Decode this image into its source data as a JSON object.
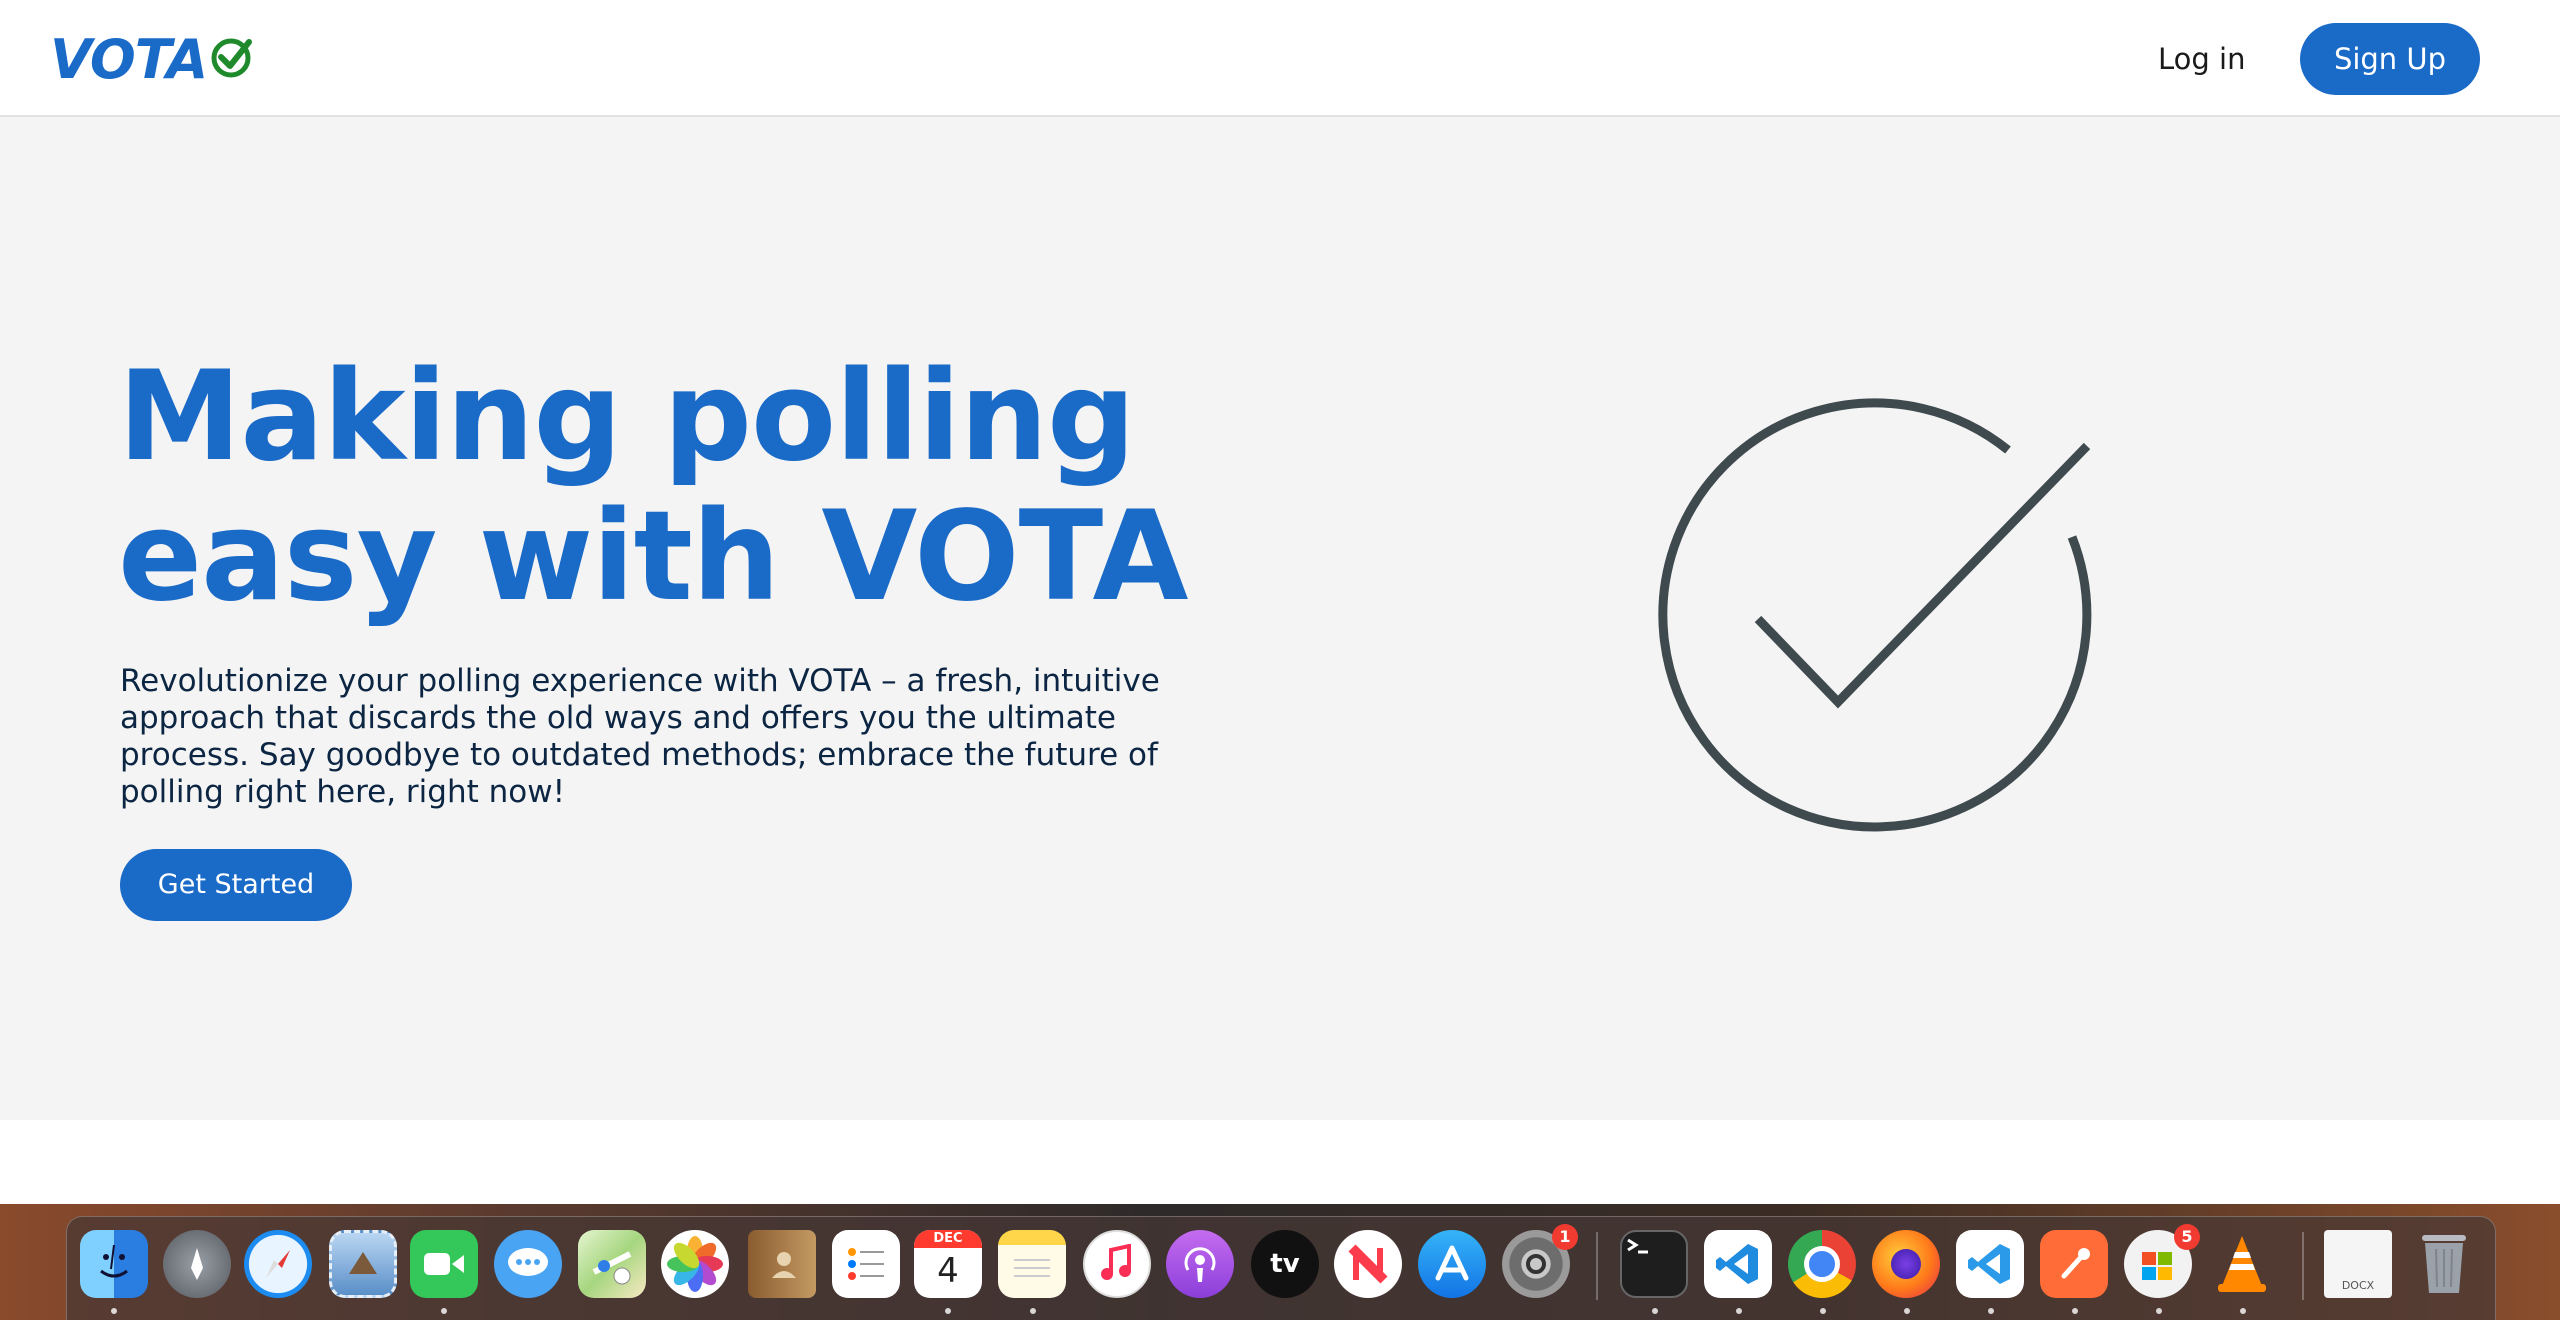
{
  "header": {
    "logo_text": "VOTA",
    "login_label": "Log in",
    "signup_label": "Sign Up"
  },
  "hero": {
    "title_line1": "Making polling",
    "title_line2": "easy with VOTA",
    "description": "Revolutionize your polling experience with VOTA – a fresh, intuitive approach that discards the old ways and offers you the ultimate process. Say goodbye to outdated methods; embrace the future of polling right here, right now!",
    "cta_label": "Get Started"
  },
  "colors": {
    "brand_blue": "#1a6ac8",
    "check_green": "#1f8a2c",
    "hero_bg": "#f4f4f4",
    "graphic_stroke": "#3f4a4e"
  },
  "dock": {
    "calendar": {
      "month": "DEC",
      "day": "4"
    },
    "system_settings_badge": "1",
    "store_badge": "5",
    "docx_label": "DOCX",
    "apple_tv_label": "tv",
    "apps": [
      "finder-icon",
      "launchpad-icon",
      "safari-icon",
      "mail-icon",
      "facetime-icon",
      "messages-icon",
      "maps-icon",
      "photos-icon",
      "contacts-icon",
      "reminders-icon",
      "calendar-icon",
      "notes-icon",
      "music-icon",
      "podcasts-icon",
      "apple-tv-icon",
      "news-icon",
      "app-store-icon",
      "system-settings-icon",
      "terminal-icon",
      "vscode-icon",
      "chrome-icon",
      "firefox-icon",
      "vscode-insiders-icon",
      "postman-icon",
      "microsoft-store-icon",
      "vlc-icon",
      "document-preview-icon",
      "trash-icon"
    ]
  }
}
